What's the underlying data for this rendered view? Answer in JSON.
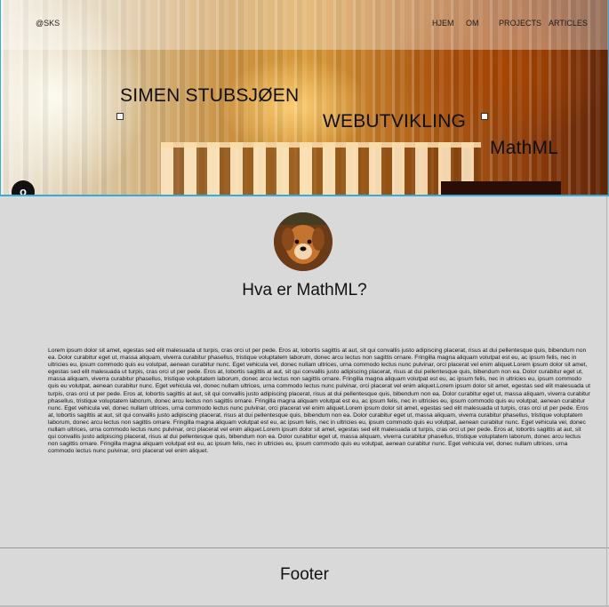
{
  "header": {
    "logo": "@SKS",
    "nav": [
      "HJEM",
      "OM",
      "PROJECTS",
      "ARTICLES"
    ]
  },
  "hero": {
    "name": "SIMEN STUBSJØEN",
    "tagline": "WEBUTVIKLING",
    "topic": "MathML",
    "corner_badge": "o"
  },
  "main": {
    "heading": "Hva er MathML?",
    "body": "Lorem ipsum dolor sit amet, egestas sed elit malesuada ut turpis, cras orci ut per pede. Eros at, lobortis sagittis at aut, sit qui convallis justo adipiscing placerat, risus at dui pellentesque quis, bibendum non ea. Dolor curabitur eget ut, massa aliquam, viverra curabitur phasellus, tristique voluptatem laborum, donec arcu lectus non sagittis ornare. Fringilla magna aliquam volutpat est eu, ac ipsum felis, nec in ultricies eu, ipsum commodo quis eu volutpat, aenean curabitur nunc. Eget vehicula vel, donec nullam ultrices, urna commodo lectus nunc pulvinar, orci placerat vel enim aliquet.Lorem ipsum dolor sit amet, egestas sed elit malesuada ut turpis, cras orci ut per pede. Eros at, lobortis sagittis at aut, sit qui convallis justo adipiscing placerat, risus at dui pellentesque quis, bibendum non ea. Dolor curabitur eget ut, massa aliquam, viverra curabitur phasellus, tristique voluptatem laborum, donec arcu lectus non sagittis ornare. Fringilla magna aliquam volutpat est eu, ac ipsum felis, nec in ultricies eu, ipsum commodo quis eu volutpat, aenean curabitur nunc. Eget vehicula vel, donec nullam ultrices, urna commodo lectus nunc pulvinar, orci placerat vel enim aliquet.Lorem ipsum dolor sit amet, egestas sed elit malesuada ut turpis, cras orci ut per pede. Eros at, lobortis sagittis at aut, sit qui convallis justo adipiscing placerat, risus at dui pellentesque quis, bibendum non ea. Dolor curabitur eget ut, massa aliquam, viverra curabitur phasellus, tristique voluptatem laborum, donec arcu lectus non sagittis ornare. Fringilla magna aliquam volutpat est eu, ac ipsum felis, nec in ultricies eu, ipsum commodo quis eu volutpat, aenean curabitur nunc. Eget vehicula vel, donec nullam ultrices, urna commodo lectus nunc pulvinar, orci placerat vel enim aliquet.Lorem ipsum dolor sit amet, egestas sed elit malesuada ut turpis, cras orci ut per pede. Eros at, lobortis sagittis at aut, sit qui convallis justo adipiscing placerat, risus at dui pellentesque quis, bibendum non ea. Dolor curabitur eget ut, massa aliquam, viverra curabitur phasellus, tristique voluptatem laborum, donec arcu lectus non sagittis ornare. Fringilla magna aliquam volutpat est eu, ac ipsum felis, nec in ultricies eu, ipsum commodo quis eu volutpat, aenean curabitur nunc. Eget vehicula vel, donec nullam ultrices, urna commodo lectus nunc pulvinar, orci placerat vel enim aliquet.Lorem ipsum dolor sit amet, egestas sed elit malesuada ut turpis, cras orci ut per pede. Eros at, lobortis sagittis at aut, sit qui convallis justo adipiscing placerat, risus at dui pellentesque quis, bibendum non ea. Dolor curabitur eget ut, massa aliquam, viverra curabitur phasellus, tristique voluptatem laborum, donec arcu lectus non sagittis ornare. Fringilla magna aliquam volutpat est eu, ac ipsum felis, nec in ultricies eu, ipsum commodo quis eu volutpat, aenean curabitur nunc. Eget vehicula vel, donec nullam ultrices, urna commodo lectus nunc pulvinar, orci placerat vel enim aliquet."
  },
  "footer": {
    "text": "Footer"
  },
  "colors": {
    "hero_border": "#39a9d6",
    "page_background": "#d9d9d9"
  }
}
